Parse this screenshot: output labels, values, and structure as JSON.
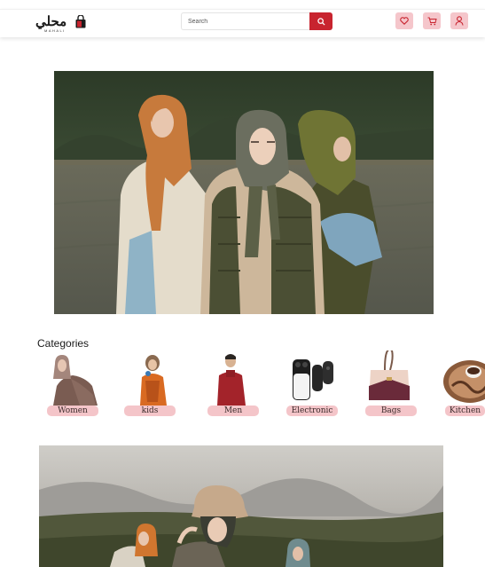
{
  "header": {
    "logo_arabic": "محلي",
    "logo_latin": "MAHALI",
    "search_placeholder": "Search",
    "icons": [
      "heart-icon",
      "cart-icon",
      "user-icon"
    ]
  },
  "categories": {
    "title": "Categories",
    "items": [
      {
        "label": "Women"
      },
      {
        "label": "kids"
      },
      {
        "label": "Men"
      },
      {
        "label": "Electronic"
      },
      {
        "label": "Bags"
      },
      {
        "label": "Kitchen"
      }
    ]
  },
  "colors": {
    "accent": "#c8242f",
    "pill": "#f4c5c9",
    "icon_button": "#f5c6cb"
  }
}
